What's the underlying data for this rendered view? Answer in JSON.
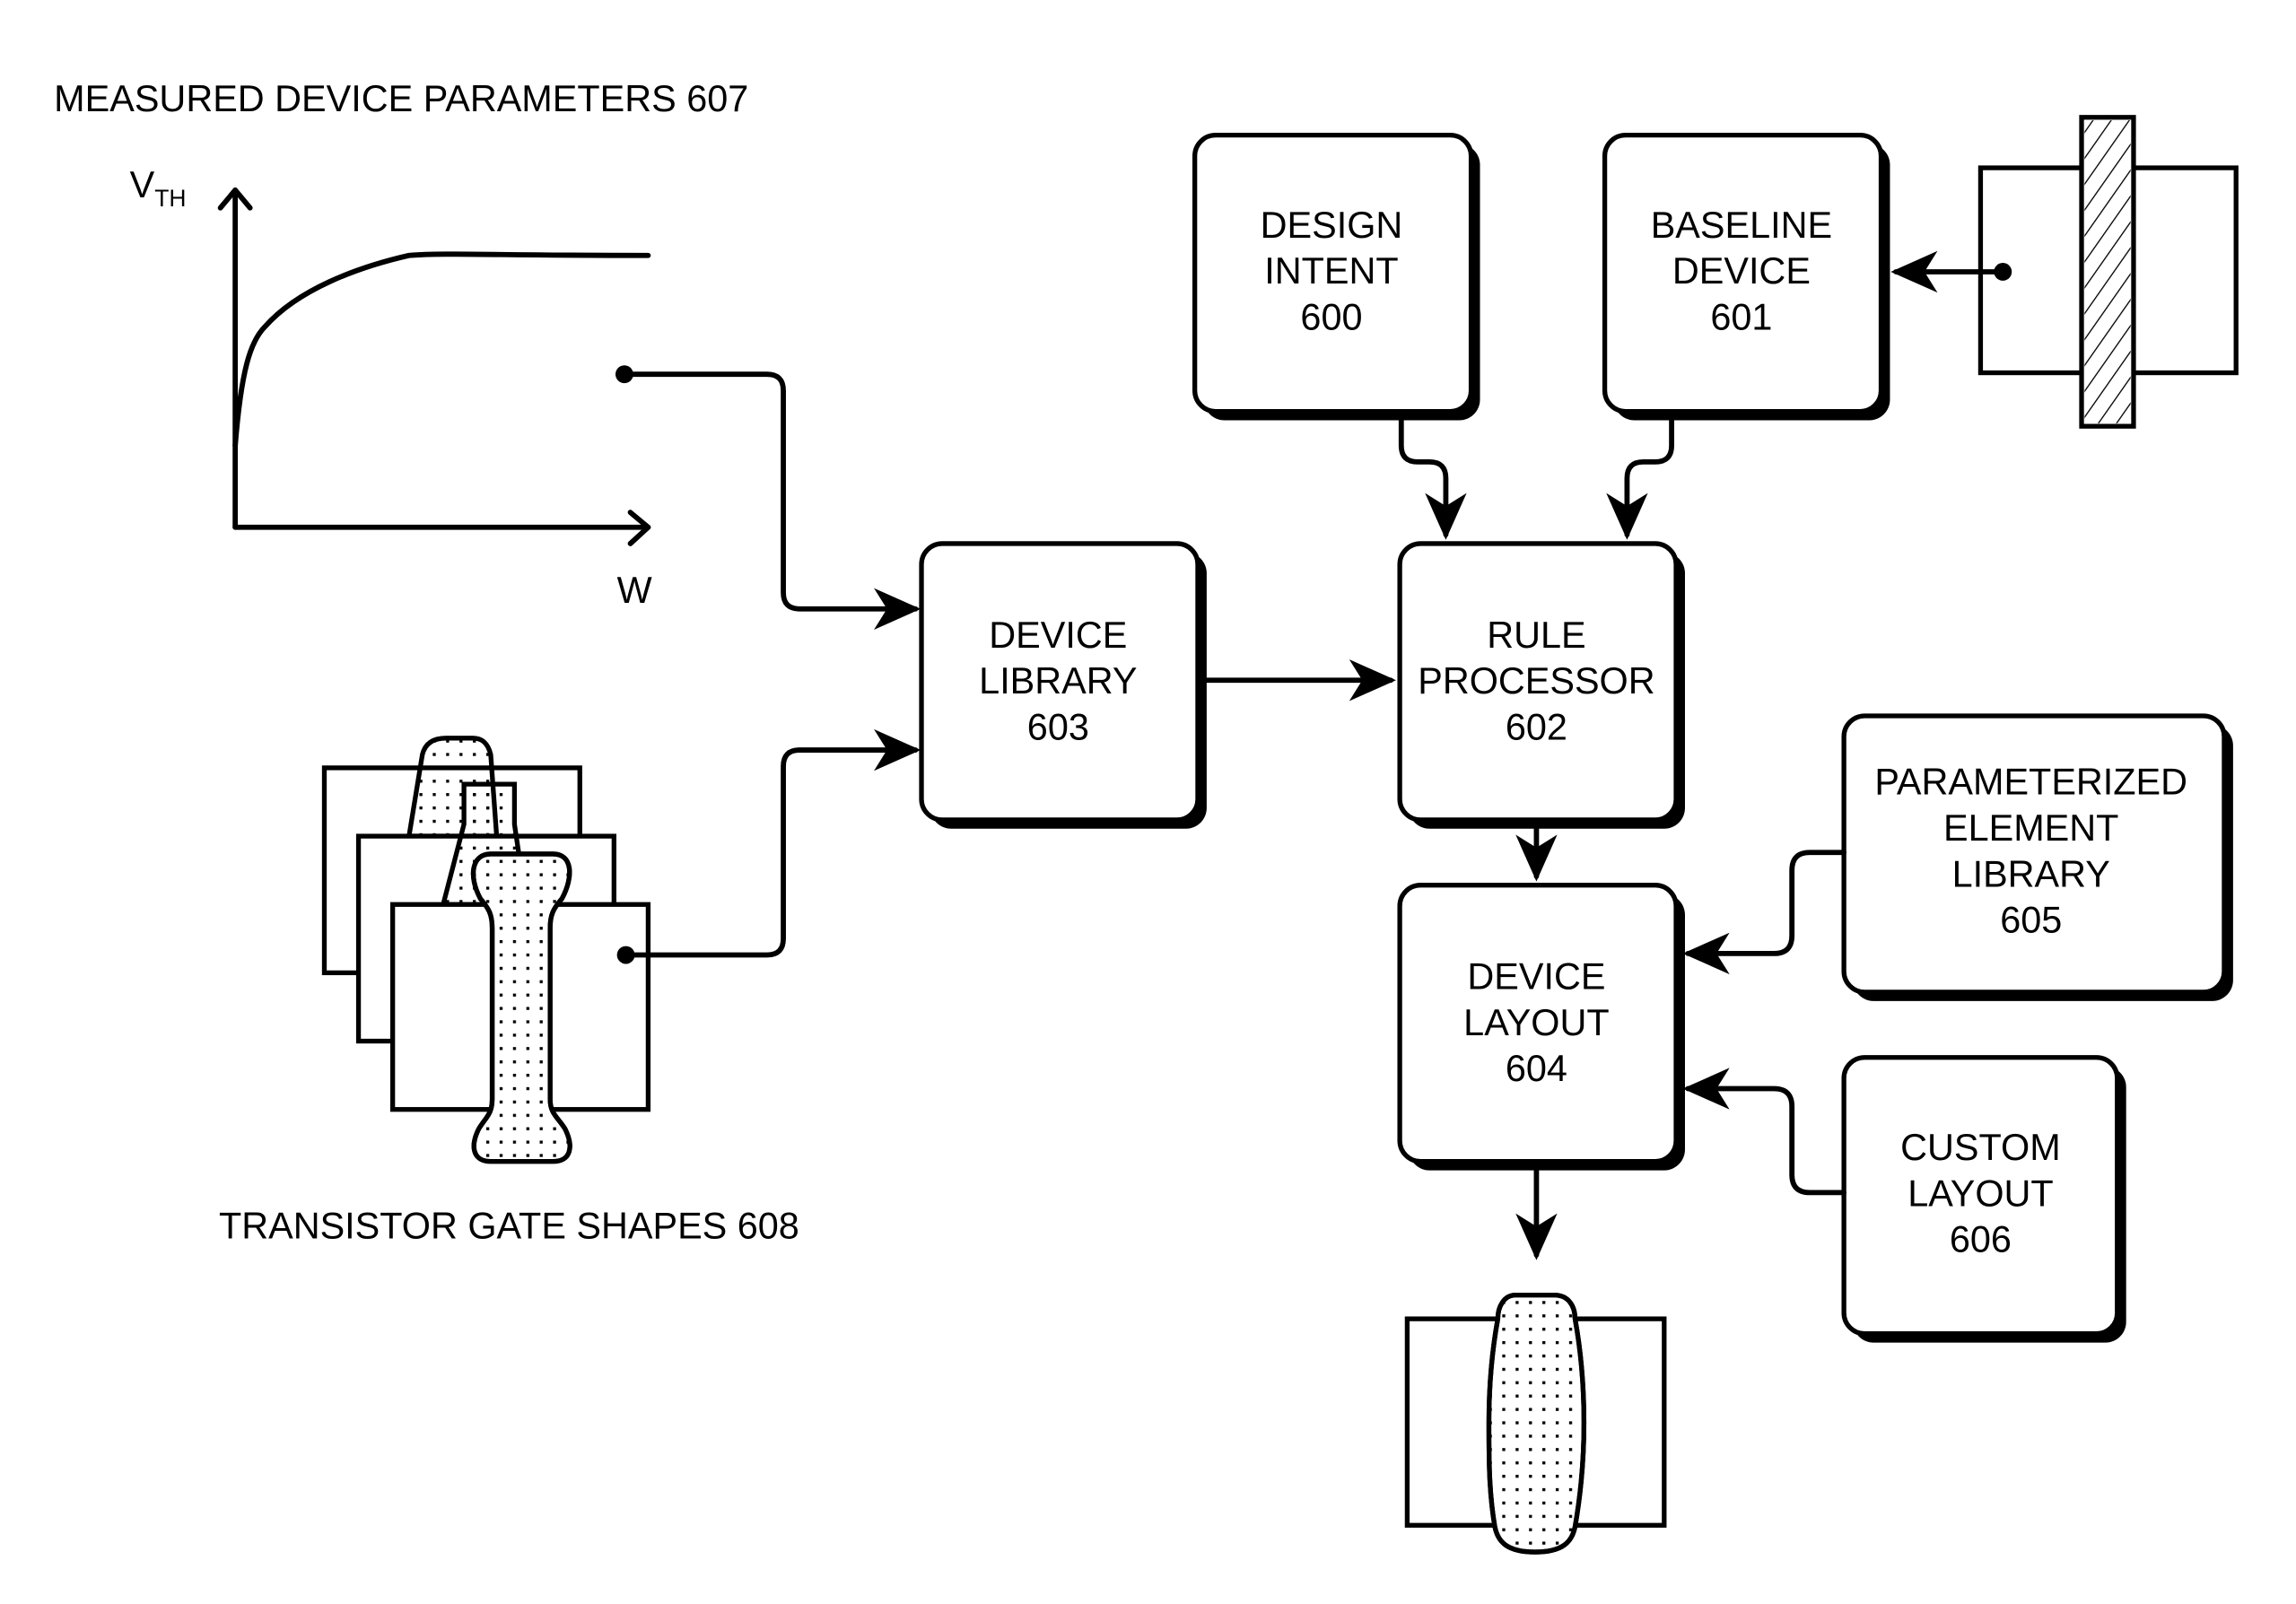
{
  "figure": {
    "measured_params": {
      "title": "MEASURED DEVICE PARAMETERS 607",
      "y_axis_label_main": "V",
      "y_axis_label_sub": "TH",
      "x_axis_label": "W"
    },
    "gate_shapes": {
      "title": "TRANSISTOR GATE SHAPES 608"
    },
    "boxes": {
      "design_intent": {
        "lines": [
          "DESIGN",
          "INTENT",
          "600"
        ]
      },
      "baseline_device": {
        "lines": [
          "BASELINE",
          "DEVICE",
          "601"
        ]
      },
      "rule_processor": {
        "lines": [
          "RULE",
          "PROCESSOR",
          "602"
        ]
      },
      "device_library": {
        "lines": [
          "DEVICE",
          "LIBRARY",
          "603"
        ]
      },
      "device_layout": {
        "lines": [
          "DEVICE",
          "LAYOUT",
          "604"
        ]
      },
      "param_element_library": {
        "lines": [
          "PARAMETERIZED",
          "ELEMENT",
          "LIBRARY",
          "605"
        ]
      },
      "custom_layout": {
        "lines": [
          "CUSTOM",
          "LAYOUT",
          "606"
        ]
      }
    },
    "connections": [
      {
        "from": "measured_params",
        "to": "device_library"
      },
      {
        "from": "gate_shapes",
        "to": "device_library"
      },
      {
        "from": "device_library",
        "to": "rule_processor"
      },
      {
        "from": "design_intent",
        "to": "rule_processor"
      },
      {
        "from": "baseline_device",
        "to": "rule_processor"
      },
      {
        "from": "baseline_transistor",
        "to": "baseline_device"
      },
      {
        "from": "rule_processor",
        "to": "device_layout"
      },
      {
        "from": "param_element_library",
        "to": "device_layout"
      },
      {
        "from": "custom_layout",
        "to": "device_layout"
      },
      {
        "from": "device_layout",
        "to": "output_transistor"
      }
    ],
    "colors": {
      "ink": "#000000",
      "background": "#ffffff"
    }
  }
}
